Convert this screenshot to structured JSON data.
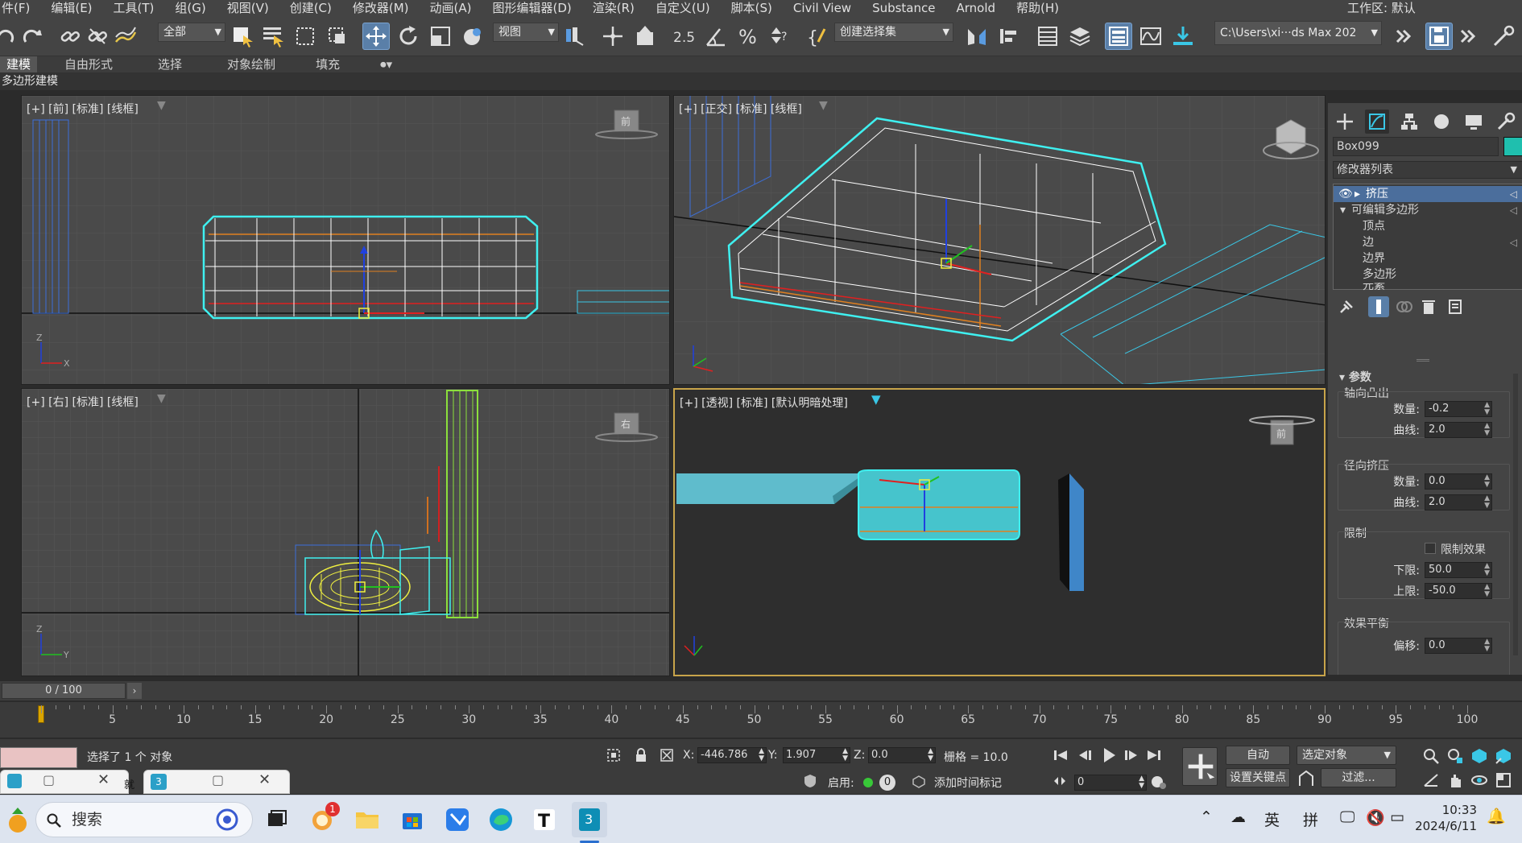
{
  "menu": [
    "件(F)",
    "编辑(E)",
    "工具(T)",
    "组(G)",
    "视图(V)",
    "创建(C)",
    "修改器(M)",
    "动画(A)",
    "图形编辑器(D)",
    "渲染(R)",
    "自定义(U)",
    "脚本(S)",
    "Civil View",
    "Substance",
    "Arnold",
    "帮助(H)"
  ],
  "workspace_label": "工作区: 默认",
  "toolbar": {
    "selection_filter": "全部",
    "ref_coord": "视图",
    "named_selection": "创建选择集",
    "project_path": "C:\\Users\\xi···ds Max 202"
  },
  "ribbon_tabs": [
    "建模",
    "自由形式",
    "选择",
    "对象绘制",
    "填充"
  ],
  "ribbon_active": "建模",
  "sub_label": "多边形建模",
  "viewports": {
    "front": {
      "label": "[+] [前] [标准] [线框]",
      "cube": "前"
    },
    "ortho": {
      "label": "[+] [正交] [标准] [线框]"
    },
    "right": {
      "label": "[+] [右] [标准] [线框]",
      "cube": "右"
    },
    "persp": {
      "label": "[+] [透视] [标准] [默认明暗处理]",
      "cube": "前"
    }
  },
  "command_panel": {
    "object_name": "Box099",
    "object_color": "#1fbfae",
    "modifier_list": "修改器列表",
    "stack": [
      {
        "label": "挤压",
        "selected": true
      },
      {
        "label": "可编辑多边形"
      },
      {
        "label": "顶点"
      },
      {
        "label": "边"
      },
      {
        "label": "边界"
      },
      {
        "label": "多边形"
      },
      {
        "label": "元素"
      }
    ],
    "params_title": "参数",
    "axial_group": "轴向凸出",
    "radial_group": "径向挤压",
    "limits_group": "限制",
    "balance_group": "效果平衡",
    "amount_label": "数量:",
    "curve_label": "曲线:",
    "limit_effect_label": "限制效果",
    "lower_label": "下限:",
    "upper_label": "上限:",
    "bias_label": "偏移:",
    "axial_amount": "-0.2",
    "axial_curve": "2.0",
    "radial_amount": "0.0",
    "radial_curve": "2.0",
    "lower_limit": "50.0",
    "upper_limit": "-50.0",
    "bias": "0.0"
  },
  "timeline": {
    "frame": "0 / 100",
    "ticks": [
      "5",
      "10",
      "15",
      "20",
      "25",
      "30",
      "35",
      "40",
      "45",
      "50",
      "55",
      "60",
      "65",
      "70",
      "75",
      "80",
      "85",
      "90",
      "95",
      "100"
    ]
  },
  "status": {
    "selected": "选择了 1 个 对象",
    "x_label": "X:",
    "x": "-446.786",
    "y_label": "Y:",
    "y": "1.907",
    "z_label": "Z:",
    "z": "0.0",
    "grid": "栅格 = 10.0",
    "enable_label": "启用:",
    "add_time_tag": "添加时间标记",
    "auto": "自动",
    "set_key": "设置关键点",
    "selected_obj": "选定对象",
    "filters": "过滤...",
    "frame_field": "0",
    "badge": "0",
    "partial_label": "就"
  },
  "taskbar": {
    "search_placeholder": "搜索",
    "lang1": "英",
    "lang2": "拼",
    "time": "10:33",
    "date": "2024/6/11",
    "mail_badge": "1"
  }
}
